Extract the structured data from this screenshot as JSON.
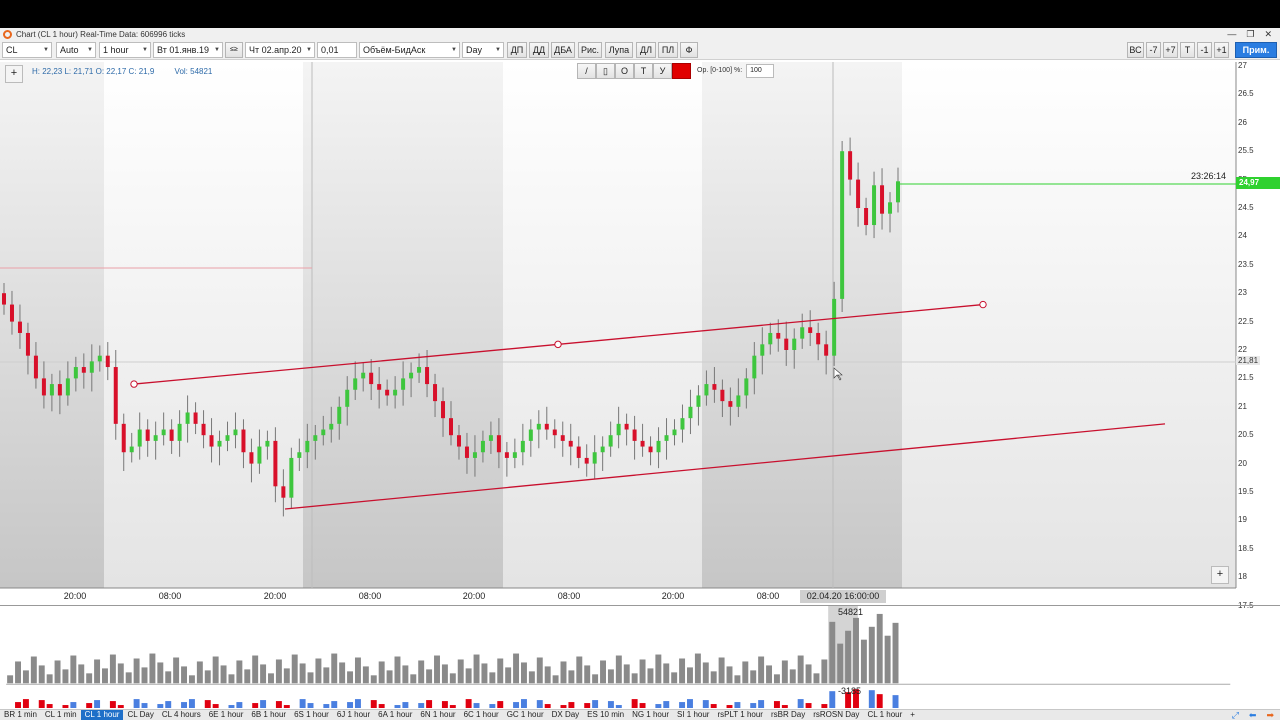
{
  "window": {
    "title": "Chart (CL 1 hour) Real-Time Data: 606996 ticks",
    "controls": [
      "—",
      "❐",
      "✕"
    ]
  },
  "toolbar": {
    "symbol": "CL",
    "scale": "Auto",
    "timeframe": "1 hour",
    "date_from": "Вт 01.янв.19",
    "date_to": "Чт 02.апр.20",
    "tick_size": "0,01",
    "indicator": "Объём-БидАск",
    "period": "Day",
    "buttons_left": [
      "ДП",
      "ДД",
      "ДБА",
      "Рис.",
      "Лупа",
      "ДЛ",
      "ПЛ",
      "Ф"
    ],
    "buttons_right": [
      "ВС",
      "-7",
      "+7",
      "T",
      "-1",
      "+1"
    ],
    "apply": "Прим."
  },
  "drawing": {
    "tools": [
      "/",
      "▯",
      "O",
      "T",
      "У"
    ],
    "opacity_label": "Ор. [0-100] %:",
    "opacity_value": "100",
    "color": "#e00000"
  },
  "info": {
    "hlc": "H: 22,23 L: 21,71 O: 22,17 C: 21,9",
    "vol": "Vol: 54821"
  },
  "price_axis": [
    "27",
    "26.5",
    "26",
    "25.5",
    "25",
    "24.5",
    "24",
    "23.5",
    "23",
    "22.5",
    "22",
    "21.5",
    "21",
    "20.5",
    "20",
    "19.5",
    "19",
    "18.5",
    "18",
    "17.5"
  ],
  "time_axis": [
    "20:00",
    "08:00",
    "20:00",
    "08:00",
    "20:00",
    "08:00",
    "20:00",
    "08:00"
  ],
  "cursor_time": "02.04.20 16:00:00",
  "last_price": "24,97",
  "cursor_price": "21,81",
  "countdown": "23:26:14",
  "volume": {
    "max_label": "54821",
    "delta_label": "-3185"
  },
  "colors": {
    "up": "#3ec63e",
    "down": "#d8102a",
    "trend": "#c8102e",
    "last": "#2fd12f",
    "accent": "#1f6fc8"
  },
  "tabs": [
    "BR 1 min",
    "CL 1 min",
    "CL 1 hour",
    "CL Day",
    "CL 4 hours",
    "6E 1 hour",
    "6B 1 hour",
    "6S 1 hour",
    "6J 1 hour",
    "6A 1 hour",
    "6N 1 hour",
    "6C 1 hour",
    "GC 1 hour",
    "DX Day",
    "ES 10 min",
    "NG 1 hour",
    "SI 1 hour",
    "rsPLT 1 hour",
    "rsBR Day",
    "rsROSN Day",
    "CL 1 hour",
    "+"
  ],
  "active_tab": 2,
  "chart_data": {
    "type": "candlestick",
    "symbol": "CL",
    "timeframe": "1 hour",
    "ylim": [
      17.5,
      27
    ],
    "closes": [
      22.8,
      22.5,
      22.3,
      21.9,
      21.5,
      21.2,
      21.4,
      21.2,
      21.5,
      21.7,
      21.6,
      21.8,
      21.9,
      21.7,
      20.7,
      20.2,
      20.3,
      20.6,
      20.4,
      20.5,
      20.6,
      20.4,
      20.7,
      20.9,
      20.7,
      20.5,
      20.3,
      20.4,
      20.5,
      20.6,
      20.2,
      20.0,
      20.3,
      20.4,
      19.6,
      19.4,
      20.1,
      20.2,
      20.4,
      20.5,
      20.6,
      20.7,
      21.0,
      21.3,
      21.5,
      21.6,
      21.4,
      21.3,
      21.2,
      21.3,
      21.5,
      21.6,
      21.7,
      21.4,
      21.1,
      20.8,
      20.5,
      20.3,
      20.1,
      20.2,
      20.4,
      20.5,
      20.2,
      20.1,
      20.2,
      20.4,
      20.6,
      20.7,
      20.6,
      20.5,
      20.4,
      20.3,
      20.1,
      20.0,
      20.2,
      20.3,
      20.5,
      20.7,
      20.6,
      20.4,
      20.3,
      20.2,
      20.4,
      20.5,
      20.6,
      20.8,
      21.0,
      21.2,
      21.4,
      21.3,
      21.1,
      21.0,
      21.2,
      21.5,
      21.9,
      22.1,
      22.3,
      22.2,
      22.0,
      22.2,
      22.4,
      22.3,
      22.1,
      21.9,
      22.9,
      25.5,
      25.0,
      24.5,
      24.2,
      24.9,
      24.4,
      24.6,
      24.97
    ],
    "trendlines": [
      {
        "from": [
          "2020-03-30 02:00",
          21.4
        ],
        "to": [
          "2020-04-03 05:00",
          22.8
        ]
      },
      {
        "from": [
          "2020-03-30 19:00",
          19.2
        ],
        "to": [
          "2020-04-03 14:00",
          20.7
        ]
      }
    ],
    "volume_max": 54821,
    "delta_last": -3185
  }
}
